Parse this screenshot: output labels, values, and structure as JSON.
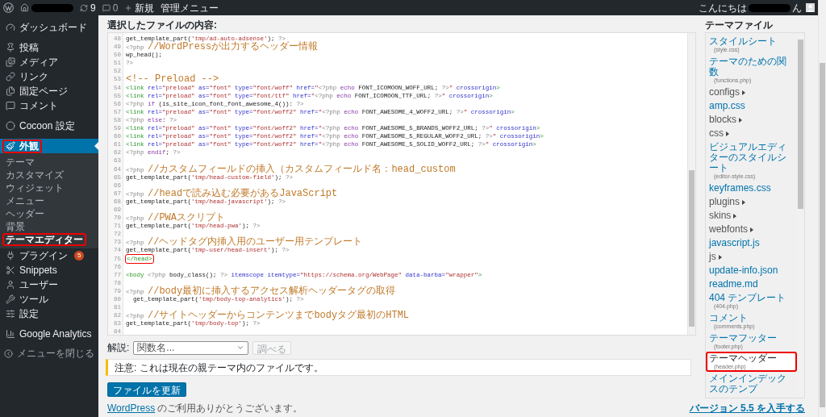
{
  "admin_bar": {
    "update_count": "9",
    "comment_count": "0",
    "new_label": "新規",
    "admin_menu": "管理メニュー",
    "greeting": "こんにちは",
    "greeting_end": "ん"
  },
  "sidebar": {
    "groups": [
      [
        {
          "label": "ダッシュボード",
          "selected": false,
          "highlighted": false
        }
      ],
      [
        {
          "label": "投稿",
          "selected": false,
          "highlighted": false
        },
        {
          "label": "メディア",
          "selected": false,
          "highlighted": false
        },
        {
          "label": "リンク",
          "selected": false,
          "highlighted": false
        },
        {
          "label": "固定ページ",
          "selected": false,
          "highlighted": false
        },
        {
          "label": "コメント",
          "selected": false,
          "highlighted": false
        }
      ],
      [
        {
          "label": "Cocoon 設定",
          "selected": false,
          "highlighted": false
        }
      ],
      [
        {
          "label": "外観",
          "selected": true,
          "highlighted": true,
          "submenu": [
            {
              "label": "テーマ",
              "selected": false,
              "highlighted": false
            },
            {
              "label": "カスタマイズ",
              "selected": false,
              "highlighted": false
            },
            {
              "label": "ウィジェット",
              "selected": false,
              "highlighted": false
            },
            {
              "label": "メニュー",
              "selected": false,
              "highlighted": false
            },
            {
              "label": "ヘッダー",
              "selected": false,
              "highlighted": false
            },
            {
              "label": "背景",
              "selected": false,
              "highlighted": false
            },
            {
              "label": "テーマエディター",
              "selected": true,
              "highlighted": true
            }
          ]
        },
        {
          "label": "プラグイン",
          "selected": false,
          "highlighted": false,
          "badge": "5"
        },
        {
          "label": "Snippets",
          "selected": false,
          "highlighted": false
        },
        {
          "label": "ユーザー",
          "selected": false,
          "highlighted": false
        },
        {
          "label": "ツール",
          "selected": false,
          "highlighted": false
        },
        {
          "label": "設定",
          "selected": false,
          "highlighted": false
        }
      ],
      [
        {
          "label": "Google Analytics",
          "selected": false,
          "highlighted": false
        }
      ]
    ],
    "collapse_label": "メニューを閉じる"
  },
  "editor": {
    "title": "選択したファイルの内容:",
    "lines": [
      {
        "number": "48",
        "highlighted": false,
        "tokens": [
          {
            "kind": "plain",
            "text": "get_template_part("
          },
          {
            "kind": "string",
            "text": "'tmp/ad-auto-adsense'"
          },
          {
            "kind": "plain",
            "text": "); "
          },
          {
            "kind": "php",
            "text": "?>"
          }
        ]
      },
      {
        "number": "49",
        "highlighted": false,
        "tokens": [
          {
            "kind": "php",
            "text": "<?php "
          },
          {
            "kind": "comment",
            "text": "//WordPressが出力するヘッダー情報"
          }
        ]
      },
      {
        "number": "50",
        "highlighted": false,
        "tokens": [
          {
            "kind": "plain",
            "text": "wp_head();"
          }
        ]
      },
      {
        "number": "51",
        "highlighted": false,
        "tokens": [
          {
            "kind": "php",
            "text": "?>"
          }
        ]
      },
      {
        "number": "52",
        "highlighted": false
      },
      {
        "number": "53",
        "highlighted": false,
        "tokens": [
          {
            "kind": "comment",
            "text": "<!-- Preload -->"
          }
        ]
      },
      {
        "number": "54",
        "highlighted": false,
        "tokens": [
          {
            "kind": "tag",
            "text": "<link "
          },
          {
            "kind": "attr",
            "text": "rel="
          },
          {
            "kind": "string",
            "text": "\"preload\""
          },
          {
            "kind": "attr",
            "text": " as="
          },
          {
            "kind": "string",
            "text": "\"font\""
          },
          {
            "kind": "attr",
            "text": " type="
          },
          {
            "kind": "string",
            "text": "\"font/woff\""
          },
          {
            "kind": "attr",
            "text": " href="
          },
          {
            "kind": "string",
            "text": "\""
          },
          {
            "kind": "php",
            "text": "<?php "
          },
          {
            "kind": "keyword",
            "text": "echo "
          },
          {
            "kind": "plain",
            "text": "FONT_ICOMOON_WOFF_URL; "
          },
          {
            "kind": "php",
            "text": "?>"
          },
          {
            "kind": "string",
            "text": "\""
          },
          {
            "kind": "attr",
            "text": " crossorigin"
          },
          {
            "kind": "tag",
            "text": ">"
          }
        ]
      },
      {
        "number": "55",
        "highlighted": false,
        "tokens": [
          {
            "kind": "tag",
            "text": "<link "
          },
          {
            "kind": "attr",
            "text": "rel="
          },
          {
            "kind": "string",
            "text": "\"preload\""
          },
          {
            "kind": "attr",
            "text": " as="
          },
          {
            "kind": "string",
            "text": "\"font\""
          },
          {
            "kind": "attr",
            "text": " type="
          },
          {
            "kind": "string",
            "text": "\"font/ttf\""
          },
          {
            "kind": "attr",
            "text": " href="
          },
          {
            "kind": "string",
            "text": "\""
          },
          {
            "kind": "php",
            "text": "<?php "
          },
          {
            "kind": "keyword",
            "text": "echo "
          },
          {
            "kind": "plain",
            "text": "FONT_ICOMOON_TTF_URL; "
          },
          {
            "kind": "php",
            "text": "?>"
          },
          {
            "kind": "string",
            "text": "\""
          },
          {
            "kind": "attr",
            "text": " crossorigin"
          },
          {
            "kind": "tag",
            "text": ">"
          }
        ]
      },
      {
        "number": "56",
        "highlighted": false,
        "tokens": [
          {
            "kind": "php",
            "text": "<?php "
          },
          {
            "kind": "keyword",
            "text": "if "
          },
          {
            "kind": "plain",
            "text": "(is_site_icon_font_font_awesome_4()): "
          },
          {
            "kind": "php",
            "text": "?>"
          }
        ]
      },
      {
        "number": "57",
        "highlighted": false,
        "tokens": [
          {
            "kind": "tag",
            "text": "<link "
          },
          {
            "kind": "attr",
            "text": "rel="
          },
          {
            "kind": "string",
            "text": "\"preload\""
          },
          {
            "kind": "attr",
            "text": " as="
          },
          {
            "kind": "string",
            "text": "\"font\""
          },
          {
            "kind": "attr",
            "text": " type="
          },
          {
            "kind": "string",
            "text": "\"font/woff2\""
          },
          {
            "kind": "attr",
            "text": " href="
          },
          {
            "kind": "string",
            "text": "\""
          },
          {
            "kind": "php",
            "text": "<?php "
          },
          {
            "kind": "keyword",
            "text": "echo "
          },
          {
            "kind": "plain",
            "text": "FONT_AWESOME_4_WOFF2_URL; "
          },
          {
            "kind": "php",
            "text": "?>"
          },
          {
            "kind": "string",
            "text": "\""
          },
          {
            "kind": "attr",
            "text": " crossorigin"
          },
          {
            "kind": "tag",
            "text": ">"
          }
        ]
      },
      {
        "number": "58",
        "highlighted": false,
        "tokens": [
          {
            "kind": "php",
            "text": "<?php "
          },
          {
            "kind": "keyword",
            "text": "else"
          },
          {
            "kind": "plain",
            "text": ": "
          },
          {
            "kind": "php",
            "text": "?>"
          }
        ]
      },
      {
        "number": "59",
        "highlighted": false,
        "tokens": [
          {
            "kind": "tag",
            "text": "<link "
          },
          {
            "kind": "attr",
            "text": "rel="
          },
          {
            "kind": "string",
            "text": "\"preload\""
          },
          {
            "kind": "attr",
            "text": " as="
          },
          {
            "kind": "string",
            "text": "\"font\""
          },
          {
            "kind": "attr",
            "text": " type="
          },
          {
            "kind": "string",
            "text": "\"font/woff2\""
          },
          {
            "kind": "attr",
            "text": " href="
          },
          {
            "kind": "string",
            "text": "\""
          },
          {
            "kind": "php",
            "text": "<?php "
          },
          {
            "kind": "keyword",
            "text": "echo "
          },
          {
            "kind": "plain",
            "text": "FONT_AWESOME_5_BRANDS_WOFF2_URL; "
          },
          {
            "kind": "php",
            "text": "?>"
          },
          {
            "kind": "string",
            "text": "\""
          },
          {
            "kind": "attr",
            "text": " crossorigin"
          },
          {
            "kind": "tag",
            "text": ">"
          }
        ]
      },
      {
        "number": "60",
        "highlighted": false,
        "tokens": [
          {
            "kind": "tag",
            "text": "<link "
          },
          {
            "kind": "attr",
            "text": "rel="
          },
          {
            "kind": "string",
            "text": "\"preload\""
          },
          {
            "kind": "attr",
            "text": " as="
          },
          {
            "kind": "string",
            "text": "\"font\""
          },
          {
            "kind": "attr",
            "text": " type="
          },
          {
            "kind": "string",
            "text": "\"font/woff2\""
          },
          {
            "kind": "attr",
            "text": " href="
          },
          {
            "kind": "string",
            "text": "\""
          },
          {
            "kind": "php",
            "text": "<?php "
          },
          {
            "kind": "keyword",
            "text": "echo "
          },
          {
            "kind": "plain",
            "text": "FONT_AWESOME_5_REGULAR_WOFF2_URL; "
          },
          {
            "kind": "php",
            "text": "?>"
          },
          {
            "kind": "string",
            "text": "\""
          },
          {
            "kind": "attr",
            "text": " crossorigin"
          },
          {
            "kind": "tag",
            "text": ">"
          }
        ]
      },
      {
        "number": "61",
        "highlighted": false,
        "tokens": [
          {
            "kind": "tag",
            "text": "<link "
          },
          {
            "kind": "attr",
            "text": "rel="
          },
          {
            "kind": "string",
            "text": "\"preload\""
          },
          {
            "kind": "attr",
            "text": " as="
          },
          {
            "kind": "string",
            "text": "\"font\""
          },
          {
            "kind": "attr",
            "text": " type="
          },
          {
            "kind": "string",
            "text": "\"font/woff2\""
          },
          {
            "kind": "attr",
            "text": " href="
          },
          {
            "kind": "string",
            "text": "\""
          },
          {
            "kind": "php",
            "text": "<?php "
          },
          {
            "kind": "keyword",
            "text": "echo "
          },
          {
            "kind": "plain",
            "text": "FONT_AWESOME_5_SOLID_WOFF2_URL; "
          },
          {
            "kind": "php",
            "text": "?>"
          },
          {
            "kind": "string",
            "text": "\""
          },
          {
            "kind": "attr",
            "text": " crossorigin"
          },
          {
            "kind": "tag",
            "text": ">"
          }
        ]
      },
      {
        "number": "62",
        "highlighted": false,
        "tokens": [
          {
            "kind": "php",
            "text": "<?php "
          },
          {
            "kind": "keyword",
            "text": "endif"
          },
          {
            "kind": "plain",
            "text": "; "
          },
          {
            "kind": "php",
            "text": "?>"
          }
        ]
      },
      {
        "number": "63",
        "highlighted": false
      },
      {
        "number": "64",
        "highlighted": false,
        "tokens": [
          {
            "kind": "php",
            "text": "<?php "
          },
          {
            "kind": "comment",
            "text": "//カスタムフィールドの挿入（カスタムフィールド名：head_custom"
          }
        ]
      },
      {
        "number": "65",
        "highlighted": false,
        "tokens": [
          {
            "kind": "plain",
            "text": "get_template_part("
          },
          {
            "kind": "string",
            "text": "'tmp/head-custom-field'"
          },
          {
            "kind": "plain",
            "text": "); "
          },
          {
            "kind": "php",
            "text": "?>"
          }
        ]
      },
      {
        "number": "66",
        "highlighted": false
      },
      {
        "number": "67",
        "highlighted": false,
        "tokens": [
          {
            "kind": "php",
            "text": "<?php "
          },
          {
            "kind": "comment",
            "text": "//headで読み込む必要があるJavaScript"
          }
        ]
      },
      {
        "number": "68",
        "highlighted": false,
        "tokens": [
          {
            "kind": "plain",
            "text": "get_template_part("
          },
          {
            "kind": "string",
            "text": "'tmp/head-javascript'"
          },
          {
            "kind": "plain",
            "text": "); "
          },
          {
            "kind": "php",
            "text": "?>"
          }
        ]
      },
      {
        "number": "69",
        "highlighted": false
      },
      {
        "number": "70",
        "highlighted": false,
        "tokens": [
          {
            "kind": "php",
            "text": "<?php "
          },
          {
            "kind": "comment",
            "text": "//PWAスクリプト"
          }
        ]
      },
      {
        "number": "71",
        "highlighted": false,
        "tokens": [
          {
            "kind": "plain",
            "text": "get_template_part("
          },
          {
            "kind": "string",
            "text": "'tmp/head-pwa'"
          },
          {
            "kind": "plain",
            "text": "); "
          },
          {
            "kind": "php",
            "text": "?>"
          }
        ]
      },
      {
        "number": "72",
        "highlighted": false
      },
      {
        "number": "73",
        "highlighted": false,
        "tokens": [
          {
            "kind": "php",
            "text": "<?php "
          },
          {
            "kind": "comment",
            "text": "//ヘッドタグ内挿入用のユーザー用テンプレート"
          }
        ]
      },
      {
        "number": "74",
        "highlighted": false,
        "tokens": [
          {
            "kind": "plain",
            "text": "get_template_part("
          },
          {
            "kind": "string",
            "text": "'tmp-user/head-insert'"
          },
          {
            "kind": "plain",
            "text": "); "
          },
          {
            "kind": "php",
            "text": "?>"
          }
        ]
      },
      {
        "number": "75",
        "highlighted": true,
        "tokens": [
          {
            "kind": "tag",
            "text": "</head>"
          }
        ]
      },
      {
        "number": "76",
        "highlighted": false
      },
      {
        "number": "77",
        "highlighted": false,
        "tokens": [
          {
            "kind": "tag",
            "text": "<body "
          },
          {
            "kind": "php",
            "text": "<?php "
          },
          {
            "kind": "plain",
            "text": "body_class(); "
          },
          {
            "kind": "php",
            "text": "?> "
          },
          {
            "kind": "attr",
            "text": "itemscope itemtype="
          },
          {
            "kind": "string",
            "text": "\"https://schema.org/WebPage\""
          },
          {
            "kind": "attr",
            "text": " data-barba="
          },
          {
            "kind": "string",
            "text": "\"wrapper\""
          },
          {
            "kind": "tag",
            "text": ">"
          }
        ]
      },
      {
        "number": "78",
        "highlighted": false
      },
      {
        "number": "79",
        "highlighted": false,
        "tokens": [
          {
            "kind": "php",
            "text": "<?php "
          },
          {
            "kind": "comment",
            "text": "//body最初に挿入するアクセス解析ヘッダータグの取得"
          }
        ]
      },
      {
        "number": "80",
        "highlighted": false,
        "tokens": [
          {
            "kind": "plain",
            "text": "  get_template_part("
          },
          {
            "kind": "string",
            "text": "'tmp/body-top-analytics'"
          },
          {
            "kind": "plain",
            "text": "); "
          },
          {
            "kind": "php",
            "text": "?>"
          }
        ]
      },
      {
        "number": "81",
        "highlighted": false
      },
      {
        "number": "82",
        "highlighted": false,
        "tokens": [
          {
            "kind": "php",
            "text": "<?php "
          },
          {
            "kind": "comment",
            "text": "//サイトヘッダーからコンテンツまでbodyタグ最初のHTML"
          }
        ]
      },
      {
        "number": "83",
        "highlighted": false,
        "tokens": [
          {
            "kind": "plain",
            "text": "get_template_part("
          },
          {
            "kind": "string",
            "text": "'tmp/body-top'"
          },
          {
            "kind": "plain",
            "text": "); "
          },
          {
            "kind": "php",
            "text": "?>"
          }
        ]
      },
      {
        "number": "84",
        "highlighted": false
      }
    ]
  },
  "lookup": {
    "label": "解説:",
    "select_value": "関数名...",
    "button": "調べる",
    "button_disabled": true
  },
  "notice": "注意: これは現在の親テーマ内のファイルです。",
  "update_button": "ファイルを更新",
  "theme_files": {
    "title": "テーマファイル",
    "items": [
      {
        "label": "スタイルシート",
        "file": "(style.css)",
        "kind": "file",
        "selected": false,
        "highlighted": false
      },
      {
        "label": "テーマのための関数",
        "file": "(functions.php)",
        "kind": "file",
        "selected": false,
        "highlighted": false
      },
      {
        "label": "configs",
        "kind": "folder",
        "selected": false,
        "highlighted": false
      },
      {
        "label": "amp.css",
        "kind": "file",
        "selected": false,
        "highlighted": false
      },
      {
        "label": "blocks",
        "kind": "folder",
        "selected": false,
        "highlighted": false
      },
      {
        "label": "css",
        "kind": "folder",
        "selected": false,
        "highlighted": false
      },
      {
        "label": "ビジュアルエディターのスタイルシート",
        "file": "(editor-style.css)",
        "kind": "file",
        "selected": false,
        "highlighted": false
      },
      {
        "label": "keyframes.css",
        "kind": "file",
        "selected": false,
        "highlighted": false
      },
      {
        "label": "plugins",
        "kind": "folder",
        "selected": false,
        "highlighted": false
      },
      {
        "label": "skins",
        "kind": "folder",
        "selected": false,
        "highlighted": false
      },
      {
        "label": "webfonts",
        "kind": "folder",
        "selected": false,
        "highlighted": false
      },
      {
        "label": "javascript.js",
        "kind": "file",
        "selected": false,
        "highlighted": false
      },
      {
        "label": "js",
        "kind": "folder",
        "selected": false,
        "highlighted": false
      },
      {
        "label": "update-info.json",
        "kind": "file",
        "selected": false,
        "highlighted": false
      },
      {
        "label": "readme.md",
        "kind": "file",
        "selected": false,
        "highlighted": false
      },
      {
        "label": "404 テンプレート",
        "file": "(404.php)",
        "kind": "file",
        "selected": false,
        "highlighted": false
      },
      {
        "label": "コメント",
        "file": "(comments.php)",
        "kind": "file",
        "selected": false,
        "highlighted": false
      },
      {
        "label": "テーマフッター",
        "file": "(footer.php)",
        "kind": "file",
        "selected": false,
        "highlighted": false
      },
      {
        "label": "テーマヘッダー",
        "file": "(header.php)",
        "kind": "file",
        "selected": true,
        "highlighted": true
      },
      {
        "label": "メインインデックスのテンプ",
        "kind": "file",
        "selected": false,
        "highlighted": false
      }
    ]
  },
  "footer": {
    "link": "WordPress",
    "text": " のご利用ありがとうございます。",
    "version_link": "バージョン 5.5 を入手する"
  }
}
